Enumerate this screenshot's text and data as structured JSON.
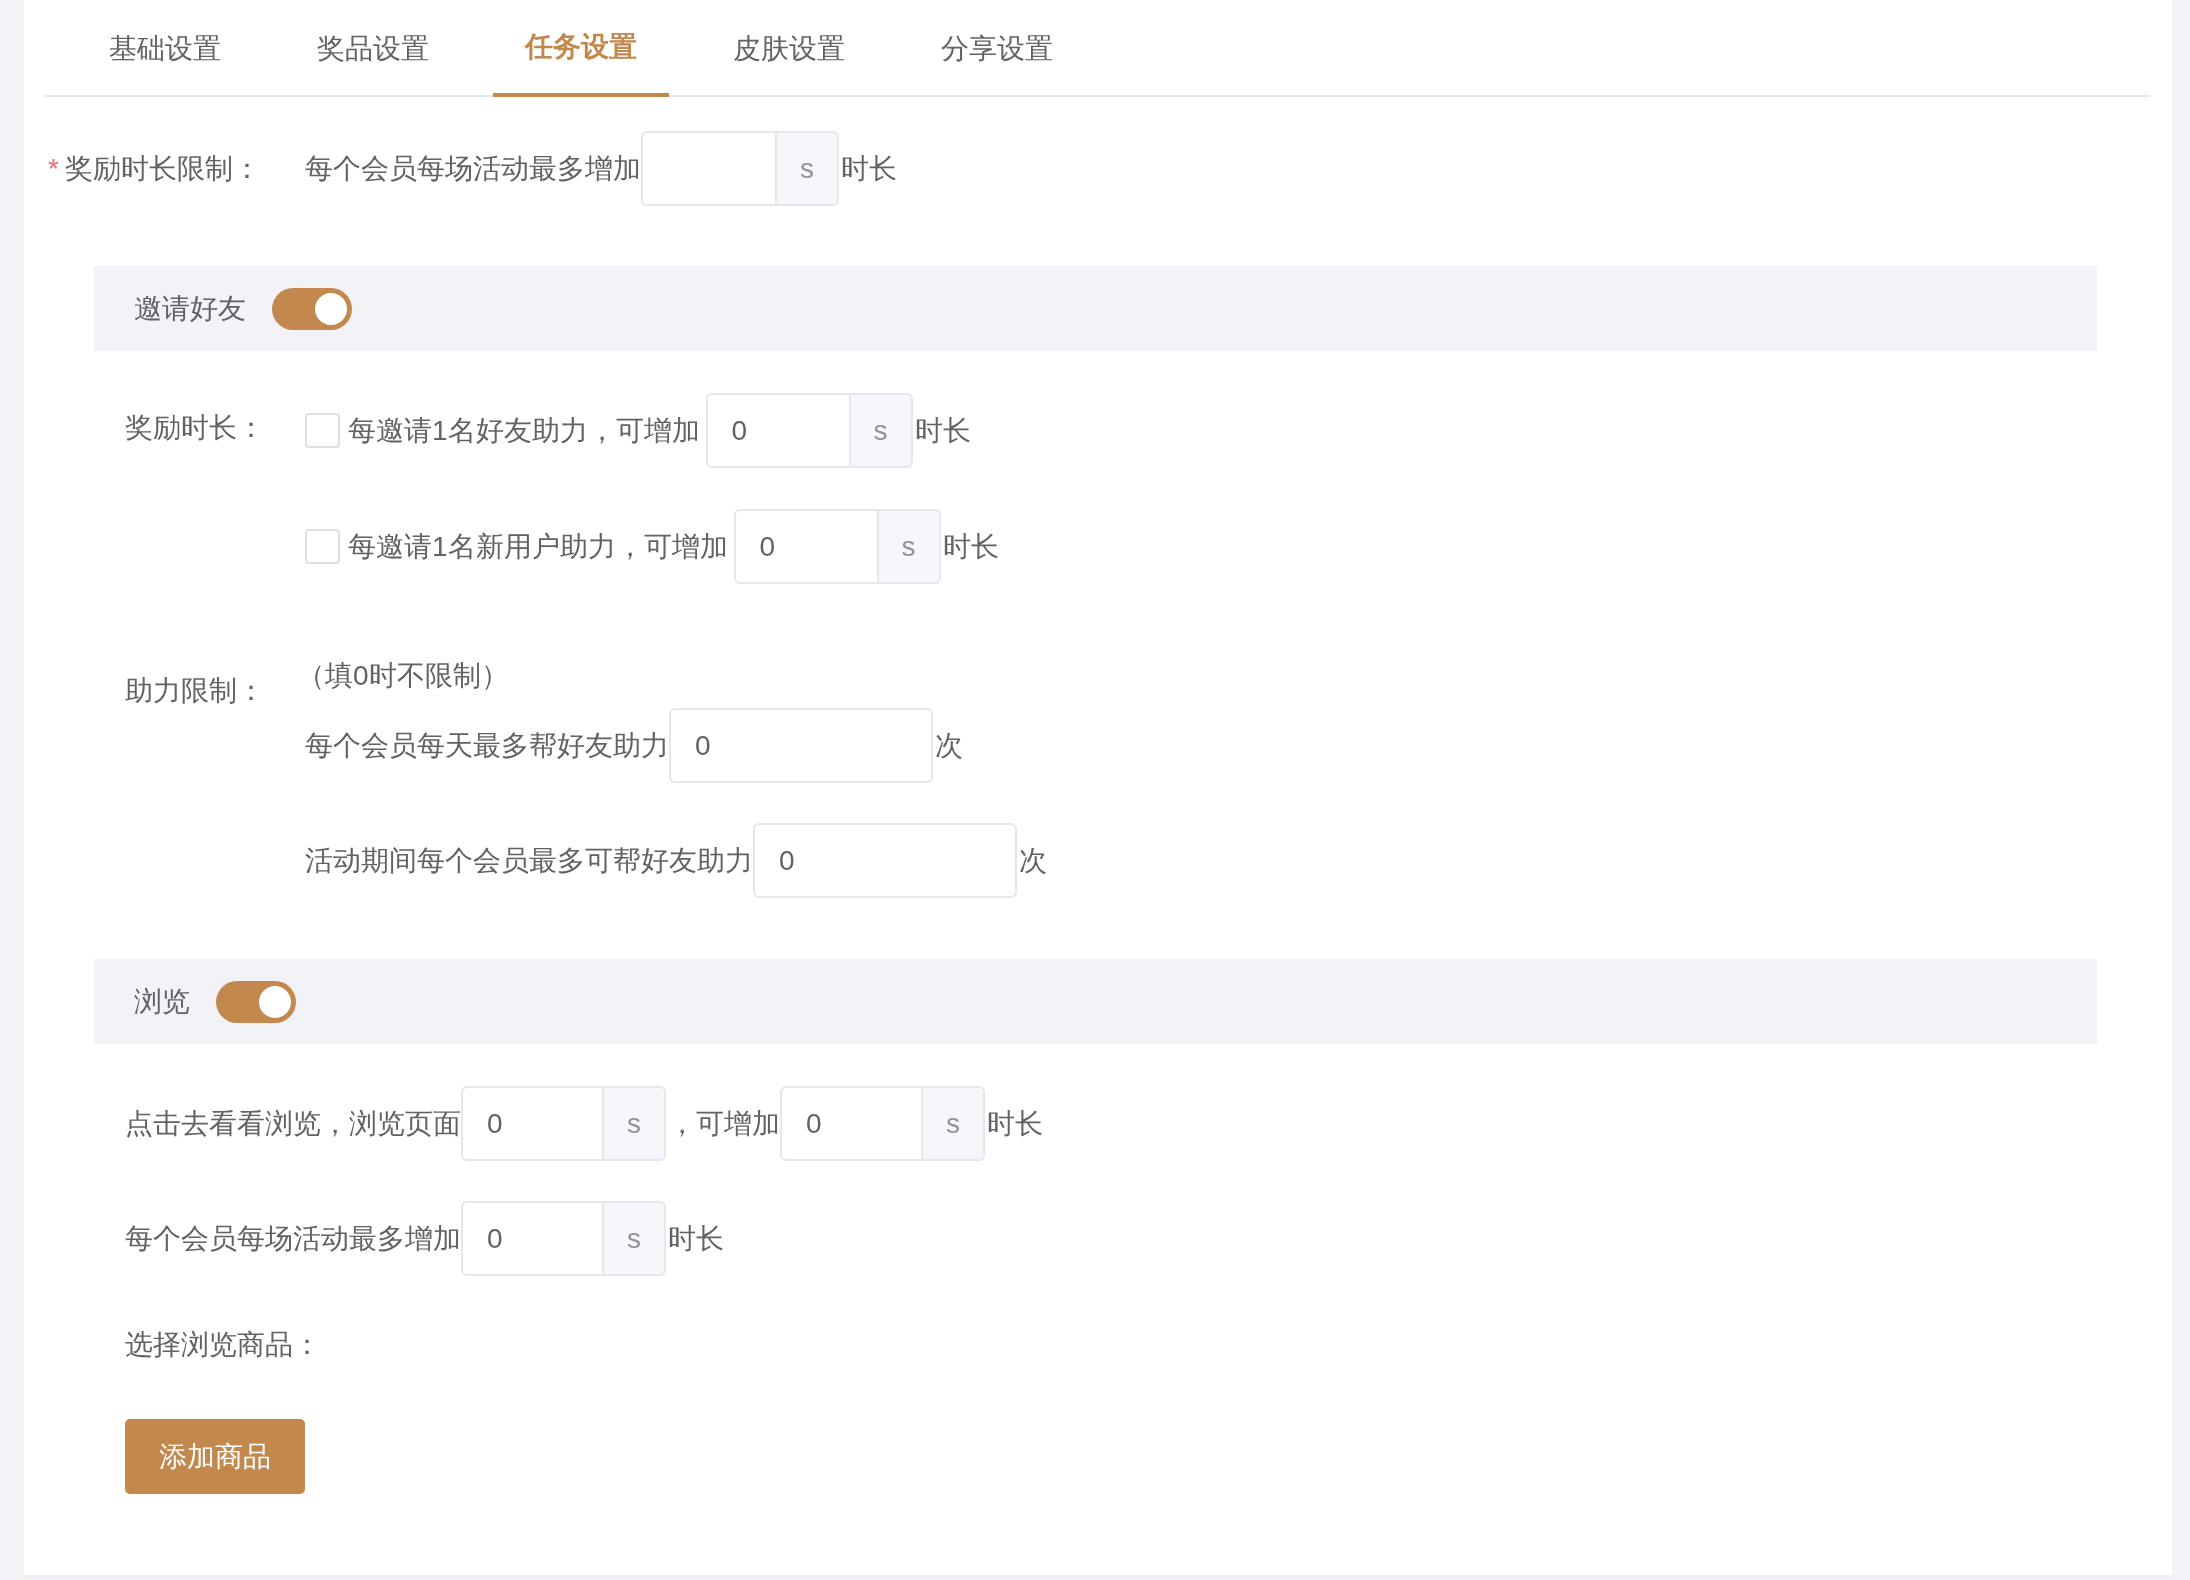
{
  "tabs": [
    {
      "label": "基础设置",
      "selected": false
    },
    {
      "label": "奖品设置",
      "selected": false
    },
    {
      "label": "任务设置",
      "selected": true
    },
    {
      "label": "皮肤设置",
      "selected": false
    },
    {
      "label": "分享设置",
      "selected": false
    }
  ],
  "reward_limit": {
    "required_mark": "*",
    "label": "奖励时长限制：",
    "text": "每个会员每场活动最多增加",
    "unit": "s",
    "suffix": "时长"
  },
  "sections": [
    {
      "kind": "invite",
      "title": "邀请好友",
      "on": true,
      "rows": [
        {
          "kind": "checkbox_input",
          "label": "奖励时长：",
          "checked": false,
          "text": "每邀请1名好友助力，可增加",
          "value": "0",
          "unit": "s",
          "suffix": "时长"
        },
        {
          "kind": "checkbox_input",
          "checked": false,
          "text": "每邀请1名新用户助力，可增加",
          "value": "0",
          "unit": "s",
          "suffix": "时长"
        },
        {
          "kind": "note",
          "label": "助力限制：",
          "text": "（填0时不限制）"
        },
        {
          "kind": "input",
          "text": "每个会员每天最多帮好友助力",
          "value": "0",
          "suffix": "次"
        },
        {
          "kind": "input",
          "text": "活动期间每个会员最多可帮好友助力",
          "value": "0",
          "suffix": "次"
        }
      ]
    },
    {
      "kind": "browse",
      "title": "浏览",
      "on": true,
      "rows": [
        {
          "kind": "double_input",
          "text": "点击去看看浏览，浏览页面",
          "value": "0",
          "unit": "s",
          "middle": "，可增加",
          "value2": "0",
          "unit2": "s",
          "suffix": "时长"
        },
        {
          "kind": "input_unit",
          "text": "每个会员每场活动最多增加",
          "value": "0",
          "unit": "s",
          "suffix": "时长"
        },
        {
          "kind": "label",
          "text": "选择浏览商品："
        },
        {
          "kind": "button",
          "text": "添加商品"
        }
      ]
    }
  ]
}
